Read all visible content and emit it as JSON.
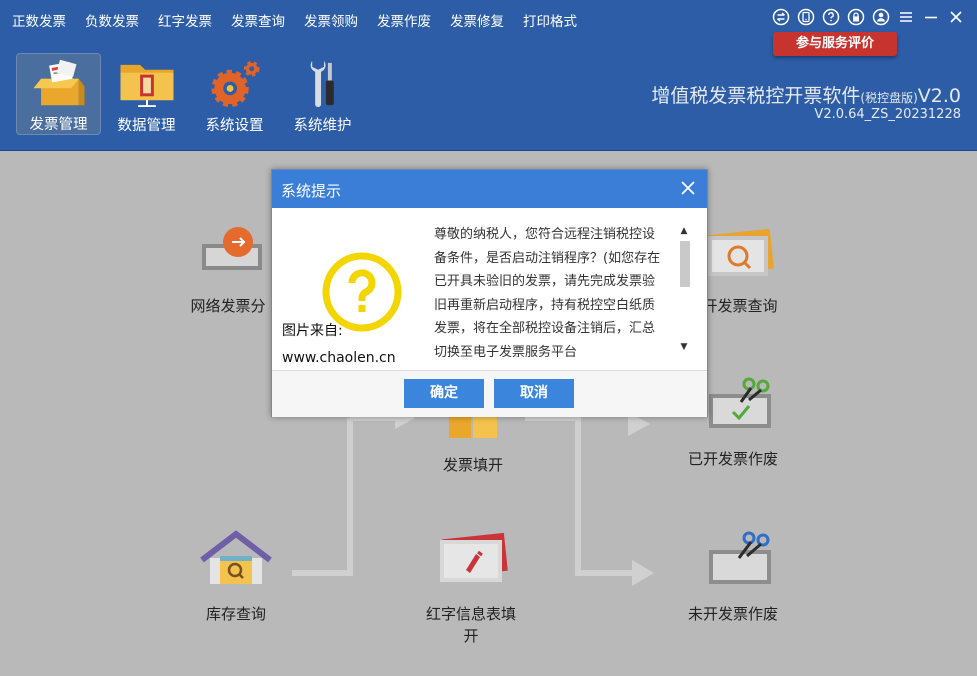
{
  "menu": [
    "正数发票",
    "负数发票",
    "红字发票",
    "发票查询",
    "发票领购",
    "发票作废",
    "发票修复",
    "打印格式"
  ],
  "window_icons": [
    "swap-icon",
    "phone-icon",
    "help-icon",
    "lock-icon",
    "user-icon",
    "menu-icon",
    "minimize-icon",
    "close-icon"
  ],
  "eval_button": "参与服务评价",
  "toolbar": [
    {
      "label": "发票管理",
      "icon": "invoice-box-icon",
      "active": true
    },
    {
      "label": "数据管理",
      "icon": "folder-icon",
      "active": false
    },
    {
      "label": "系统设置",
      "icon": "gears-icon",
      "active": false
    },
    {
      "label": "系统维护",
      "icon": "tools-icon",
      "active": false
    }
  ],
  "app": {
    "title": "增值税发票税控开票软件",
    "title_sub": "(税控盘版)",
    "title_ver": "V2.0",
    "version": "V2.0.64_ZS_20231228"
  },
  "flow": {
    "network_distribute": "网络发票分",
    "issued_query": "开发票查询",
    "fill_invoice": "发票填开",
    "void_issued": "已开发票作废",
    "stock_query": "库存查询",
    "red_info_fill": "红字信息表填",
    "red_info_fill_2": "开",
    "void_unissued": "未开发票作废"
  },
  "dialog": {
    "title": "系统提示",
    "watermark_line1": "图片来自:",
    "watermark_line2": "www.chaolen.cn",
    "message": "尊敬的纳税人，您符合远程注销税控设备条件，是否启动注销程序？(如您存在已开具未验旧的发票，请先完成发票验旧再重新启动程序，持有税控空白纸质发票，将在全部税控设备注销后，汇总切换至电子发票服务平台",
    "ok": "确定",
    "cancel": "取消"
  },
  "colors": {
    "header_bg": "#2c5da6",
    "dialog_title_bg": "#3b7ed8",
    "button_bg": "#3c85dc",
    "eval_bg": "#c7332f",
    "question_yellow": "#f3d500"
  }
}
